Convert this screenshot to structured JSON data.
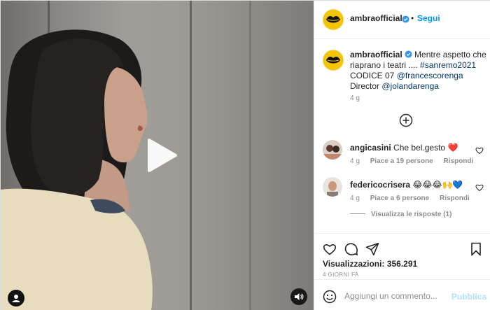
{
  "post": {
    "username": "ambraofficial",
    "follow_label": "Segui",
    "separator": "•"
  },
  "caption": {
    "username": "ambraofficial",
    "text_part1": "Mentre aspetto che riaprano i teatri .... ",
    "hashtag": "#sanremo2021",
    "text_part2": " CODICE 07 ",
    "mention1": "@francescorenga",
    "text_part3": " Director ",
    "mention2": "@jolandarenga",
    "time": "4 g"
  },
  "comments": [
    {
      "username": "angicasini",
      "text": "Che bel.gesto",
      "emoji": "❤️",
      "time": "4 g",
      "likes": "Piace a 19 persone",
      "reply_label": "Rispondi"
    },
    {
      "username": "federicocrisera",
      "text": "",
      "emoji": "😂😂😂🙌💙",
      "time": "4 g",
      "likes": "Piace a 6 persone",
      "reply_label": "Rispondi"
    }
  ],
  "replies_label": "Visualizza le risposte (1)",
  "stats": {
    "views_label": "Visualizzazioni:",
    "views_count": "356.291",
    "date": "4 GIORNI FA"
  },
  "comment_box": {
    "placeholder": "Aggiungi un commento...",
    "publish_label": "Pubblica"
  },
  "icons": {
    "play": "play-icon",
    "volume": "volume-icon",
    "load_more": "plus-circle-icon",
    "like": "heart-icon",
    "comment": "comment-bubble-icon",
    "share": "paper-plane-icon",
    "save": "bookmark-icon",
    "emoji": "smiley-icon",
    "verified": "verified-badge-icon"
  },
  "colors": {
    "accent": "#0095f6",
    "link": "#00376b",
    "muted": "#8e8e8e",
    "avatar_bg": "#f5c400",
    "heart": "#ed4956"
  }
}
